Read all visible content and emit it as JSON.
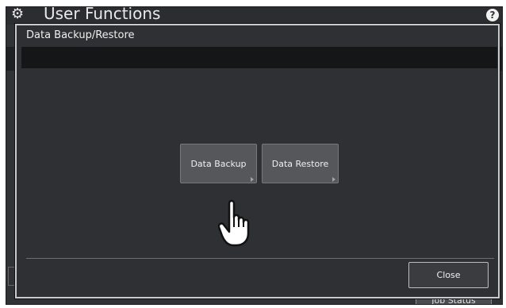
{
  "app": {
    "title": "User Functions",
    "help_label": "?",
    "job_status_label": "Job Status"
  },
  "dialog": {
    "title": "Data Backup/Restore",
    "buttons": [
      {
        "label": "Data Backup"
      },
      {
        "label": "Data Restore"
      }
    ],
    "close_label": "Close"
  },
  "icons": {
    "settings": "gear-icon",
    "help": "help-icon",
    "pointer": "hand-cursor-icon",
    "submenu": "chevron-right-icon"
  },
  "colors": {
    "background": "#303235",
    "dialog_border": "#c9cacc",
    "button": "#55575b",
    "text": "#f0f0f0"
  }
}
